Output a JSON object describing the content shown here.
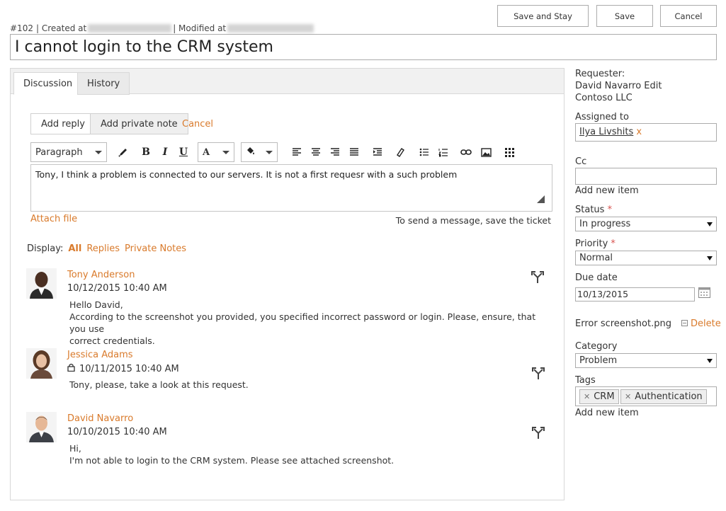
{
  "header": {
    "ticket_id": "#102",
    "created_label": "| Created at",
    "modified_label": "| Modified at",
    "title": "I cannot login to the CRM system"
  },
  "actions": {
    "save_and_stay": "Save and Stay",
    "save": "Save",
    "cancel": "Cancel"
  },
  "tabs": [
    {
      "label": "Discussion",
      "active": true
    },
    {
      "label": "History",
      "active": false
    }
  ],
  "reply": {
    "add_reply": "Add reply",
    "add_private_note": "Add private note",
    "cancel": "Cancel",
    "format_select": "Paragraph",
    "editor_text": "Tony, I think a problem is connected to our servers. It is not a first requesr with a such problem",
    "attach_file": "Attach file",
    "send_hint": "To send a message, save the ticket"
  },
  "toolbar_icons": [
    "pencil-icon",
    "bold-icon",
    "italic-icon",
    "underline-icon",
    "font-color-icon",
    "highlight-icon",
    "align-left-icon",
    "align-center-icon",
    "align-right-icon",
    "align-justify-icon",
    "indent-icon",
    "eraser-icon",
    "bullet-list-icon",
    "numbered-list-icon",
    "link-icon",
    "image-icon",
    "table-icon"
  ],
  "display": {
    "label": "Display:",
    "all": "All",
    "replies": "Replies",
    "private_notes": "Private Notes"
  },
  "messages": [
    {
      "author": "Tony Anderson",
      "date": "10/12/2015 10:40 AM",
      "private": false,
      "lines": [
        "Hello David,",
        "According to the screenshot you provided, you specified incorrect password or login. Please, ensure, that you use",
        "correct credentials."
      ]
    },
    {
      "author": "Jessica Adams",
      "date": "10/11/2015 10:40 AM",
      "private": true,
      "lines": [
        "Tony, please, take a look at this request."
      ]
    },
    {
      "author": "David Navarro",
      "date": "10/10/2015 10:40 AM",
      "private": false,
      "lines": [
        "Hi,",
        "I'm not able to login to the CRM system. Please see attached screenshot."
      ]
    }
  ],
  "sidebar": {
    "requester_label": "Requester:",
    "requester_name": "David Navarro Edit",
    "requester_company": "Contoso LLC",
    "assigned_label": "Assigned to",
    "assigned_value": "Ilya Livshits",
    "assigned_remove": "x",
    "cc_label": "Cc",
    "cc_add": "Add new item",
    "status_label": "Status",
    "status_value": "In progress",
    "priority_label": "Priority",
    "priority_value": "Normal",
    "required_mark": "*",
    "due_label": "Due date",
    "due_value": "10/13/2015",
    "attachment": "Error screenshot.png",
    "delete": "Delete",
    "category_label": "Category",
    "category_value": "Problem",
    "tags_label": "Tags",
    "tags": [
      "CRM",
      "Authentication"
    ],
    "tags_add": "Add new item"
  },
  "colors": {
    "accent": "#d97a2b",
    "border": "#ababab",
    "tab_bar": "#f1f1f1"
  }
}
